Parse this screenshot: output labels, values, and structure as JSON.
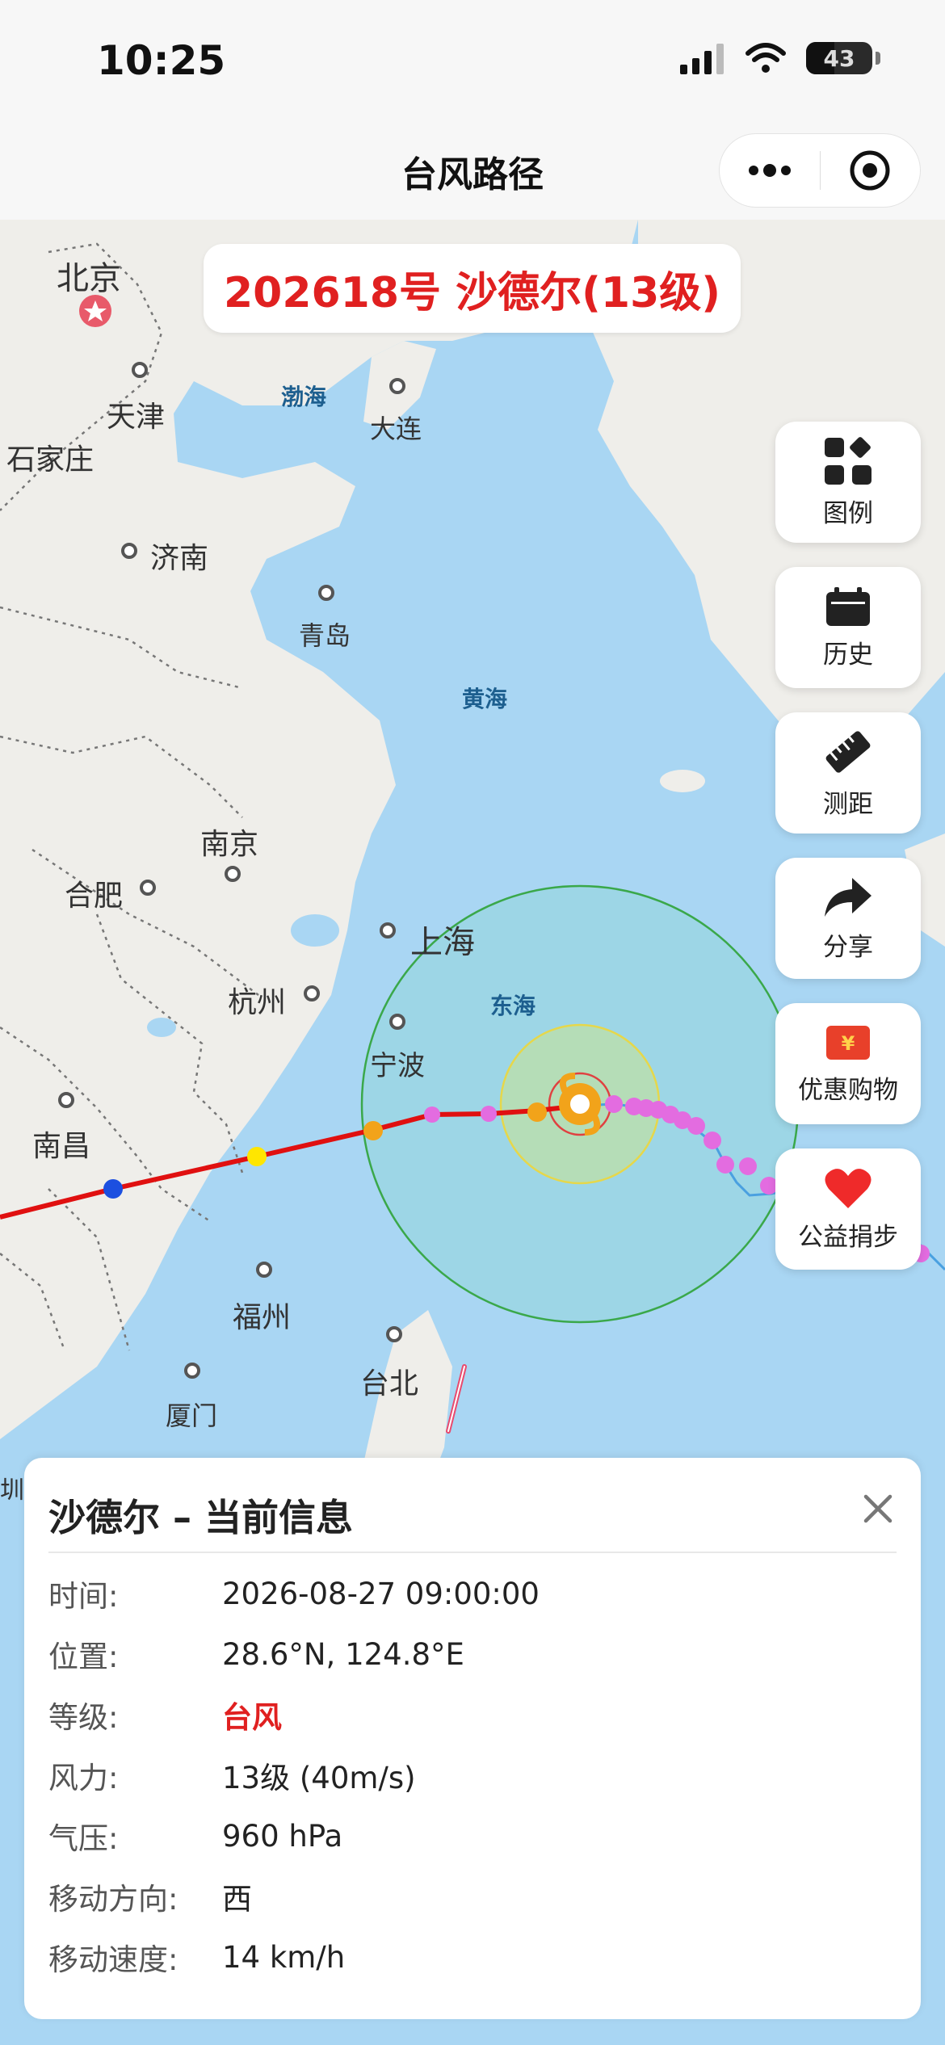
{
  "status": {
    "time": "10:25",
    "battery": "43"
  },
  "nav": {
    "title": "台风路径"
  },
  "typhoon": {
    "title": "202618号 沙德尔(13级)"
  },
  "map": {
    "cities": {
      "beijing": "北京",
      "tianjin": "天津",
      "shijiazhuang": "石家庄",
      "dalian": "大连",
      "jinan": "济南",
      "qingdao": "青岛",
      "nanjing": "南京",
      "hefei": "合肥",
      "shanghai": "上海",
      "hangzhou": "杭州",
      "ningbo": "宁波",
      "nanchang": "南昌",
      "fuzhou": "福州",
      "taibei": "台北",
      "xiamen": "厦门",
      "shen": "圳"
    },
    "seas": {
      "bohai": "渤海",
      "huanghai": "黄海",
      "donghai": "东海"
    }
  },
  "side_buttons": [
    {
      "label": "图例",
      "icon": "legend-icon"
    },
    {
      "label": "历史",
      "icon": "calendar-icon"
    },
    {
      "label": "测距",
      "icon": "ruler-icon"
    },
    {
      "label": "分享",
      "icon": "share-icon"
    },
    {
      "label": "优惠购物",
      "icon": "coupon-icon"
    },
    {
      "label": "公益捐步",
      "icon": "heart-icon"
    }
  ],
  "info": {
    "title": "沙德尔 – 当前信息",
    "rows": [
      {
        "key": "时间:",
        "value": "2026-08-27 09:00:00"
      },
      {
        "key": "位置:",
        "value": "28.6°N, 124.8°E"
      },
      {
        "key": "等级:",
        "value": "台风"
      },
      {
        "key": "风力:",
        "value": "13级 (40m/s)"
      },
      {
        "key": "气压:",
        "value": "960 hPa"
      },
      {
        "key": "移动方向:",
        "value": "西"
      },
      {
        "key": "移动速度:",
        "value": "14 km/h"
      }
    ]
  },
  "colors": {
    "accent_red": "#e02020",
    "sea": "#a9d6f3",
    "land": "#efeeea"
  }
}
